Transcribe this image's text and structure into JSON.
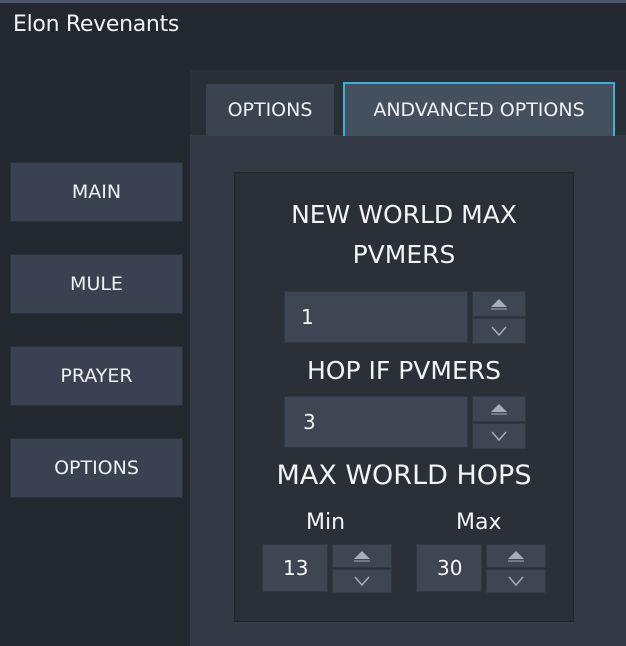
{
  "window": {
    "title": "Elon Revenants"
  },
  "sidebar": {
    "items": [
      {
        "label": "MAIN"
      },
      {
        "label": "MULE"
      },
      {
        "label": "PRAYER"
      },
      {
        "label": "OPTIONS"
      }
    ]
  },
  "tabs": [
    {
      "label": "OPTIONS",
      "active": false
    },
    {
      "label": "ANDVANCED OPTIONS",
      "active": true
    }
  ],
  "advanced": {
    "new_world_max_pvmers": {
      "label_line1": "NEW WORLD MAX",
      "label_line2": "PVMERS",
      "value": "1"
    },
    "hop_if_pvmers": {
      "label": "HOP IF PVMERS",
      "value": "3"
    },
    "max_world_hops": {
      "label": "MAX WORLD HOPS",
      "min_label": "Min",
      "min_value": "13",
      "max_label": "Max",
      "max_value": "30"
    }
  },
  "icons": {
    "increment": "triangle-up-icon",
    "decrement": "chevron-down-icon"
  },
  "colors": {
    "accent": "#3ab0d8",
    "background": "#23272e",
    "panel": "#343a45"
  }
}
